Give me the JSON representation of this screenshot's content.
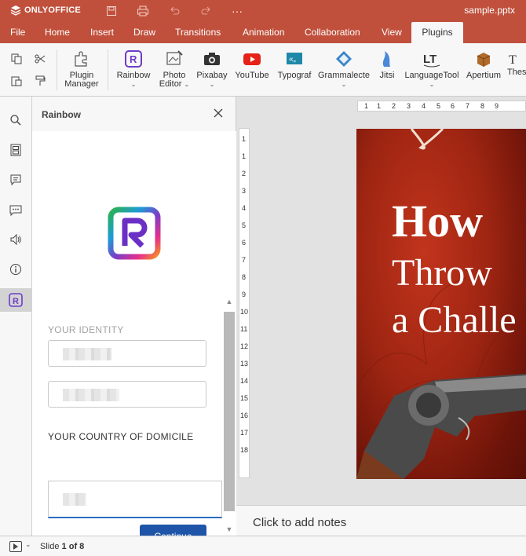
{
  "app": {
    "logo_text": "ONLYOFFICE",
    "document_title": "sample.pptx"
  },
  "titlebar_icons": [
    "save-icon",
    "print-icon",
    "undo-icon",
    "redo-icon",
    "more-icon"
  ],
  "menu": {
    "tabs": [
      {
        "label": "File"
      },
      {
        "label": "Home"
      },
      {
        "label": "Insert"
      },
      {
        "label": "Draw"
      },
      {
        "label": "Transitions"
      },
      {
        "label": "Animation"
      },
      {
        "label": "Collaboration"
      },
      {
        "label": "View"
      },
      {
        "label": "Plugins"
      }
    ],
    "active": "Plugins"
  },
  "toolbar": {
    "plugins": [
      {
        "label": "Plugin",
        "label2": "Manager"
      },
      {
        "label": "Rainbow"
      },
      {
        "label": "Photo",
        "label2": "Editor"
      },
      {
        "label": "Pixabay"
      },
      {
        "label": "YouTube"
      },
      {
        "label": "Typograf"
      },
      {
        "label": "Grammalecte"
      },
      {
        "label": "Jitsi"
      },
      {
        "label": "LanguageTool"
      },
      {
        "label": "Apertium"
      },
      {
        "label": "Thes"
      }
    ]
  },
  "panel": {
    "title": "Rainbow",
    "identity_label": "YOUR IDENTITY",
    "country_label": "YOUR COUNTRY OF DOMICILE",
    "continue_label": "Continue"
  },
  "slide": {
    "line1": "How",
    "line2": "Throw",
    "line3": "a Challe"
  },
  "ruler": {
    "h_ticks": [
      "1",
      "1",
      "2",
      "3",
      "4",
      "5",
      "6",
      "7",
      "8",
      "9"
    ],
    "v_ticks": [
      "1",
      "1",
      "2",
      "3",
      "4",
      "5",
      "6",
      "7",
      "8",
      "9",
      "10",
      "11",
      "12",
      "13",
      "14",
      "15",
      "16",
      "17",
      "18"
    ]
  },
  "notes": {
    "placeholder": "Click to add notes"
  },
  "status": {
    "slide_prefix": "Slide",
    "current": "1",
    "of_label": "of",
    "total": "8"
  },
  "colors": {
    "brand": "#c0503c",
    "accent_button": "#1e55a8",
    "focus_underline": "#2b6cc2"
  }
}
